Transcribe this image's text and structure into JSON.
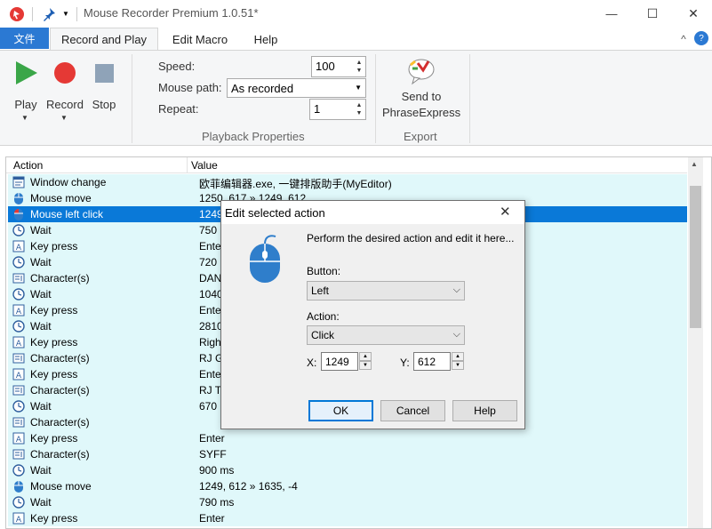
{
  "titlebar": {
    "title": "Mouse Recorder Premium 1.0.51*",
    "minimize_glyph": "—",
    "maximize_glyph": "☐",
    "close_glyph": "✕",
    "collapse_glyph": "^",
    "qat_dropdown_glyph": "▼"
  },
  "menu": {
    "file": "文件",
    "tabs": [
      "Record and Play",
      "Edit Macro",
      "Help"
    ]
  },
  "ribbon": {
    "play": "Play",
    "record": "Record",
    "stop": "Stop",
    "speed_label": "Speed:",
    "speed_value": "100",
    "mouse_path_label": "Mouse path:",
    "mouse_path_value": "As recorded",
    "repeat_label": "Repeat:",
    "repeat_value": "1",
    "playback_group": "Playback Properties",
    "send_line1": "Send to",
    "send_line2": "PhraseExpress",
    "export_group": "Export"
  },
  "list": {
    "col_action": "Action",
    "col_value": "Value",
    "rows": [
      {
        "action": "Window change",
        "value": "欧菲编辑器.exe, 一键排版助手(MyEditor)",
        "icon": "window-icon"
      },
      {
        "action": "Mouse move",
        "value": "1250, 617 » 1249, 612",
        "icon": "mouse-icon"
      },
      {
        "action": "Mouse left click",
        "value": "1249",
        "icon": "mouse-click-icon",
        "selected": true
      },
      {
        "action": "Wait",
        "value": "750 m",
        "icon": "clock-icon"
      },
      {
        "action": "Key press",
        "value": "Enter",
        "icon": "key-icon"
      },
      {
        "action": "Wait",
        "value": "720 m",
        "icon": "clock-icon"
      },
      {
        "action": "Character(s)",
        "value": "DANC",
        "icon": "text-icon"
      },
      {
        "action": "Wait",
        "value": "1040",
        "icon": "clock-icon"
      },
      {
        "action": "Key press",
        "value": "Enter",
        "icon": "key-icon"
      },
      {
        "action": "Wait",
        "value": "2810",
        "icon": "clock-icon"
      },
      {
        "action": "Key press",
        "value": "Right",
        "icon": "key-icon"
      },
      {
        "action": "Character(s)",
        "value": "RJ GC",
        "icon": "text-icon"
      },
      {
        "action": "Key press",
        "value": "Enter",
        "icon": "key-icon"
      },
      {
        "action": "Character(s)",
        "value": "RJ TS",
        "icon": "text-icon"
      },
      {
        "action": "Wait",
        "value": "670 m",
        "icon": "clock-icon"
      },
      {
        "action": "Character(s)",
        "value": "",
        "icon": "text-icon"
      },
      {
        "action": "Key press",
        "value": "Enter",
        "icon": "key-icon"
      },
      {
        "action": "Character(s)",
        "value": "SYFF",
        "icon": "text-icon"
      },
      {
        "action": "Wait",
        "value": "900 ms",
        "icon": "clock-icon"
      },
      {
        "action": "Mouse move",
        "value": "1249, 612 » 1635, -4",
        "icon": "mouse-icon"
      },
      {
        "action": "Wait",
        "value": "790 ms",
        "icon": "clock-icon"
      },
      {
        "action": "Key press",
        "value": "Enter",
        "icon": "key-icon"
      }
    ]
  },
  "dialog": {
    "title": "Edit selected action",
    "close_glyph": "✕",
    "description": "Perform the desired action and edit it here...",
    "button_label": "Button:",
    "button_value": "Left",
    "action_label": "Action:",
    "action_value": "Click",
    "x_label": "X:",
    "x_value": "1249",
    "y_label": "Y:",
    "y_value": "612",
    "ok": "OK",
    "cancel": "Cancel",
    "help": "Help"
  },
  "colors": {
    "accent": "#2b79d3",
    "selection": "#0a79d8",
    "row_bg": "#e0f8fa",
    "play_green": "#3aa648",
    "record_red": "#e53935",
    "stop_gray": "#8fa3b8",
    "mouse_blue": "#2f7ecb"
  }
}
